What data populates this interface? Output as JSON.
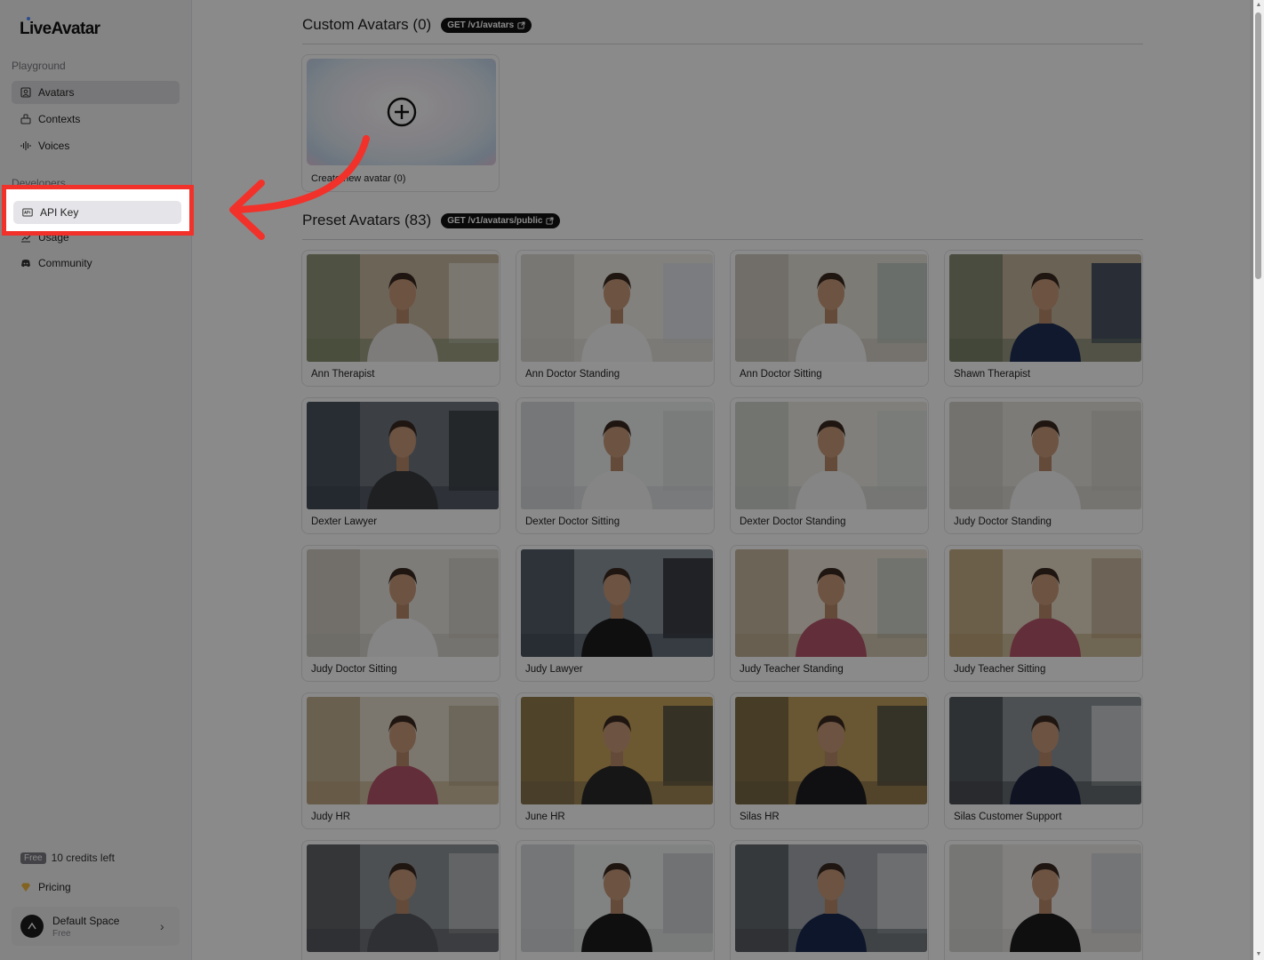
{
  "app": {
    "logo": "LiveAvatar"
  },
  "sidebar": {
    "sections": [
      {
        "label": "Playground"
      },
      {
        "label": "Developers"
      }
    ],
    "items": [
      {
        "label": "Avatars",
        "icon": "avatar-icon"
      },
      {
        "label": "Contexts",
        "icon": "contexts-icon"
      },
      {
        "label": "Voices",
        "icon": "waveform-icon"
      },
      {
        "label": "API Key",
        "icon": "key-icon"
      },
      {
        "label": "Usage",
        "icon": "chart-icon"
      },
      {
        "label": "Community",
        "icon": "discord-icon"
      }
    ],
    "credits": {
      "badge": "Free",
      "text": "10 credits left"
    },
    "pricing": {
      "label": "Pricing",
      "icon": "diamond-icon"
    },
    "space": {
      "name": "Default Space",
      "plan": "Free"
    }
  },
  "main": {
    "custom": {
      "title": "Custom Avatars (0)",
      "endpoint": "GET /v1/avatars",
      "create_label": "Create new avatar (0)"
    },
    "preset": {
      "title": "Preset Avatars (83)",
      "endpoint": "GET /v1/avatars/public",
      "avatars": [
        {
          "name": "Ann Therapist"
        },
        {
          "name": "Ann Doctor Standing"
        },
        {
          "name": "Ann Doctor Sitting"
        },
        {
          "name": "Shawn Therapist"
        },
        {
          "name": "Dexter Lawyer"
        },
        {
          "name": "Dexter Doctor Sitting"
        },
        {
          "name": "Dexter Doctor Standing"
        },
        {
          "name": "Judy Doctor Standing"
        },
        {
          "name": "Judy Doctor Sitting"
        },
        {
          "name": "Judy Lawyer"
        },
        {
          "name": "Judy Teacher Standing"
        },
        {
          "name": "Judy Teacher Sitting"
        },
        {
          "name": "Judy HR"
        },
        {
          "name": "June HR"
        },
        {
          "name": "Silas HR"
        },
        {
          "name": "Silas Customer Support"
        },
        {
          "name": ""
        },
        {
          "name": ""
        },
        {
          "name": ""
        },
        {
          "name": ""
        }
      ]
    }
  },
  "colors": {
    "highlight": "#f2312a",
    "overlay": "rgba(0,0,0,0.46)"
  }
}
